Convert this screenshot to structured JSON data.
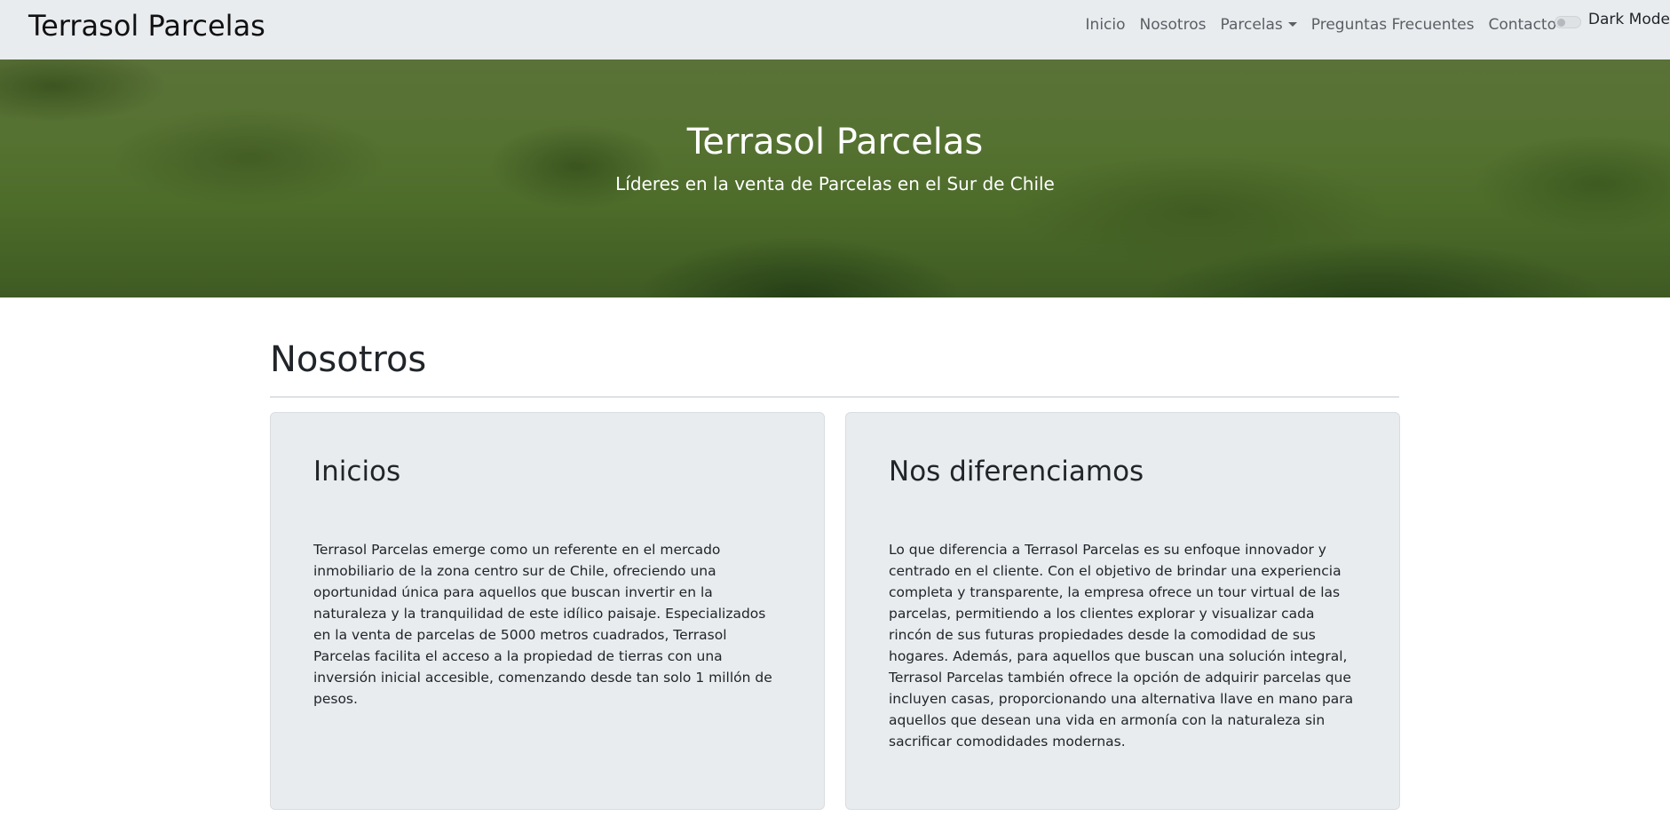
{
  "navbar": {
    "brand": "Terrasol Parcelas",
    "links": [
      "Inicio",
      "Nosotros",
      "Parcelas",
      "Preguntas Frecuentes",
      "Contacto"
    ],
    "dark_mode_label": "Dark Mode",
    "dark_mode_on": false
  },
  "hero": {
    "title": "Terrasol Parcelas",
    "subtitle": "Líderes en la venta de Parcelas en el Sur de Chile"
  },
  "section": {
    "title": "Nosotros"
  },
  "cards": [
    {
      "title": "Inicios",
      "text": "Terrasol Parcelas emerge como un referente en el mercado inmobiliario de la zona centro sur de Chile, ofreciendo una oportunidad única para aquellos que buscan invertir en la naturaleza y la tranquilidad de este idílico paisaje. Especializados en la venta de parcelas de 5000 metros cuadrados, Terrasol Parcelas facilita el acceso a la propiedad de tierras con una inversión inicial accesible, comenzando desde tan solo 1 millón de pesos."
    },
    {
      "title": "Nos diferenciamos",
      "text": "Lo que diferencia a Terrasol Parcelas es su enfoque innovador y centrado en el cliente. Con el objetivo de brindar una experiencia completa y transparente, la empresa ofrece un tour virtual de las parcelas, permitiendo a los clientes explorar y visualizar cada rincón de sus futuras propiedades desde la comodidad de sus hogares. Además, para aquellos que buscan una solución integral, Terrasol Parcelas también ofrece la opción de adquirir parcelas que incluyen casas, proporcionando una alternativa llave en mano para aquellos que desean una vida en armonía con la naturaleza sin sacrificar comodidades modernas."
    }
  ]
}
